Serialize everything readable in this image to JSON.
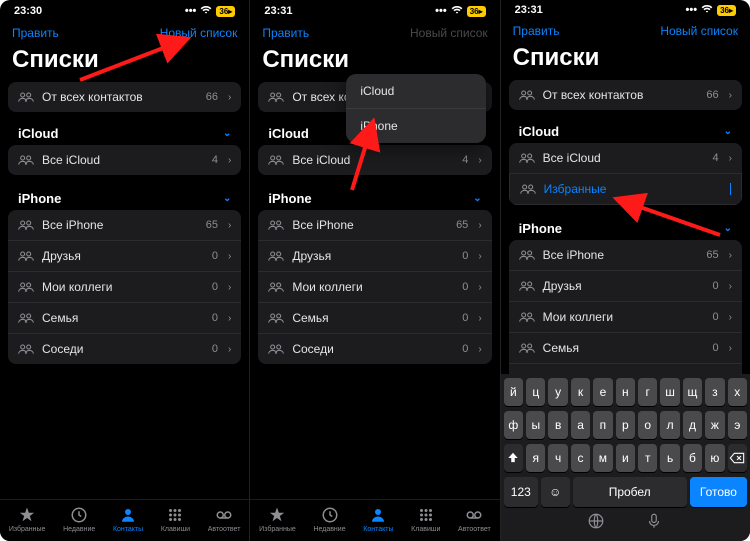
{
  "accent": "#0a84ff",
  "screens": [
    {
      "time": "23:30",
      "battery": "36",
      "nav_left": "Править",
      "nav_right": "Новый список",
      "nav_right_dim": false,
      "title": "Списки",
      "all_contacts": {
        "label": "От всех контактов",
        "count": 66
      },
      "sections": [
        {
          "name": "iCloud",
          "rows": [
            {
              "label": "Все iCloud",
              "count": 4
            }
          ]
        },
        {
          "name": "iPhone",
          "rows": [
            {
              "label": "Все iPhone",
              "count": 65
            },
            {
              "label": "Друзья",
              "count": 0
            },
            {
              "label": "Мои коллеги",
              "count": 0
            },
            {
              "label": "Семья",
              "count": 0
            },
            {
              "label": "Соседи",
              "count": 0
            }
          ]
        }
      ],
      "popup": null,
      "editing": null,
      "tabbar": true,
      "keyboard": false
    },
    {
      "time": "23:31",
      "battery": "36",
      "nav_left": "Править",
      "nav_right": "Новый список",
      "nav_right_dim": true,
      "title": "Списки",
      "all_contacts": {
        "label": "От всех контактов",
        "count": 66
      },
      "sections": [
        {
          "name": "iCloud",
          "rows": [
            {
              "label": "Все iCloud",
              "count": 4
            }
          ]
        },
        {
          "name": "iPhone",
          "rows": [
            {
              "label": "Все iPhone",
              "count": 65
            },
            {
              "label": "Друзья",
              "count": 0
            },
            {
              "label": "Мои коллеги",
              "count": 0
            },
            {
              "label": "Семья",
              "count": 0
            },
            {
              "label": "Соседи",
              "count": 0
            }
          ]
        }
      ],
      "popup": {
        "options": [
          "iCloud",
          "iPhone"
        ]
      },
      "editing": null,
      "tabbar": true,
      "keyboard": false
    },
    {
      "time": "23:31",
      "battery": "36",
      "nav_left": "Править",
      "nav_right": "Новый список",
      "nav_right_dim": false,
      "title": "Списки",
      "all_contacts": {
        "label": "От всех контактов",
        "count": 66
      },
      "sections": [
        {
          "name": "iCloud",
          "rows": [
            {
              "label": "Все iCloud",
              "count": 4
            }
          ],
          "editing": {
            "label": "Избранные"
          }
        },
        {
          "name": "iPhone",
          "rows": [
            {
              "label": "Все iPhone",
              "count": 65
            },
            {
              "label": "Друзья",
              "count": 0
            },
            {
              "label": "Мои коллеги",
              "count": 0
            },
            {
              "label": "Семья",
              "count": 0
            },
            {
              "label": "Соседи",
              "count": 0
            }
          ]
        }
      ],
      "popup": null,
      "tabbar": false,
      "keyboard": true
    }
  ],
  "tabs": [
    {
      "id": "favorites",
      "label": "Избранные"
    },
    {
      "id": "recents",
      "label": "Недавние"
    },
    {
      "id": "contacts",
      "label": "Контакты",
      "active": true
    },
    {
      "id": "keypad",
      "label": "Клавиши"
    },
    {
      "id": "voicemail",
      "label": "Автоответ"
    }
  ],
  "keyboard": {
    "rows": [
      [
        "й",
        "ц",
        "у",
        "к",
        "е",
        "н",
        "г",
        "ш",
        "щ",
        "з",
        "х"
      ],
      [
        "ф",
        "ы",
        "в",
        "а",
        "п",
        "р",
        "о",
        "л",
        "д",
        "ж",
        "э"
      ],
      [
        "я",
        "ч",
        "с",
        "м",
        "и",
        "т",
        "ь",
        "б",
        "ю"
      ]
    ],
    "numkey": "123",
    "space": "Пробел",
    "done": "Готово"
  }
}
